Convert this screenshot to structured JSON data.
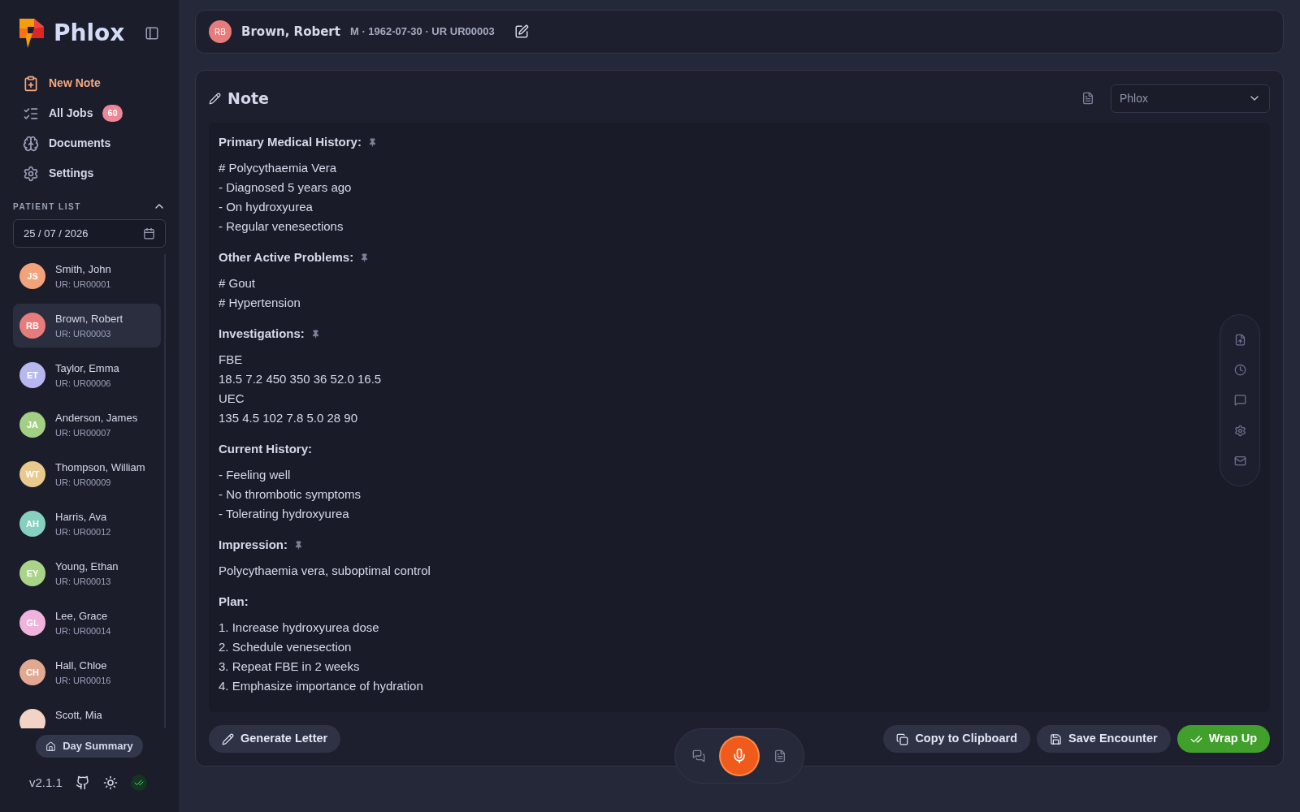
{
  "app": {
    "name": "Phlox",
    "version": "v2.1.1"
  },
  "nav": [
    {
      "kind": "new-note",
      "label": "New Note",
      "selected": true
    },
    {
      "kind": "jobs",
      "label": "All Jobs",
      "badge": "60",
      "selected": false
    },
    {
      "kind": "documents",
      "label": "Documents",
      "selected": false
    },
    {
      "kind": "settings",
      "label": "Settings",
      "selected": false
    }
  ],
  "patient_list": {
    "title": "PATIENT LIST",
    "expanded": true,
    "date": "25 / 07 / 2026",
    "patients": [
      {
        "initials": "JS",
        "name": "Smith, John",
        "ur": "UR: UR00001",
        "color": "#f4a27a",
        "selected": false
      },
      {
        "initials": "RB",
        "name": "Brown, Robert",
        "ur": "UR: UR00003",
        "color": "#e77c7c",
        "selected": true
      },
      {
        "initials": "ET",
        "name": "Taylor, Emma",
        "ur": "UR: UR00006",
        "color": "#b8b8f0",
        "selected": false
      },
      {
        "initials": "JA",
        "name": "Anderson, James",
        "ur": "UR: UR00007",
        "color": "#a3cf84",
        "selected": false
      },
      {
        "initials": "WT",
        "name": "Thompson, William",
        "ur": "UR: UR00009",
        "color": "#e8c98e",
        "selected": false
      },
      {
        "initials": "AH",
        "name": "Harris, Ava",
        "ur": "UR: UR00012",
        "color": "#86d0c0",
        "selected": false
      },
      {
        "initials": "EY",
        "name": "Young, Ethan",
        "ur": "UR: UR00013",
        "color": "#a8d488",
        "selected": false
      },
      {
        "initials": "GL",
        "name": "Lee, Grace",
        "ur": "UR: UR00014",
        "color": "#f0b4dc",
        "selected": false
      },
      {
        "initials": "CH",
        "name": "Hall, Chloe",
        "ur": "UR: UR00016",
        "color": "#e2a992",
        "selected": false
      },
      {
        "name": "Scott, Mia",
        "color": "#f3d3c6",
        "selected": false
      }
    ]
  },
  "day_summary": "Day Summary",
  "header": {
    "initials": "RB",
    "name": "Brown, Robert",
    "details": "M · 1962-07-30 · UR UR00003"
  },
  "note": {
    "title": "Note",
    "template": "Phlox",
    "sections": [
      {
        "heading": "Primary Medical History:",
        "pinned": true,
        "lines": [
          "# Polycythaemia Vera",
          "- Diagnosed 5 years ago",
          "- On hydroxyurea",
          "- Regular venesections"
        ]
      },
      {
        "heading": "Other Active Problems:",
        "pinned": true,
        "lines": [
          "# Gout",
          "# Hypertension"
        ]
      },
      {
        "heading": "Investigations:",
        "pinned": true,
        "lines": [
          "FBE",
          "18.5 7.2 450 350 36 52.0 16.5",
          "UEC",
          "135 4.5 102 7.8 5.0 28 90"
        ]
      },
      {
        "heading": "Current History:",
        "pinned": false,
        "lines": [
          "- Feeling well",
          "- No thrombotic symptoms",
          "- Tolerating hydroxyurea"
        ]
      },
      {
        "heading": "Impression:",
        "pinned": true,
        "lines": [
          "Polycythaemia vera, suboptimal control"
        ]
      },
      {
        "heading": "Plan:",
        "pinned": false,
        "lines": [
          "1. Increase hydroxyurea dose",
          "2. Schedule venesection",
          "3. Repeat FBE in 2 weeks",
          "4. Emphasize importance of hydration"
        ]
      }
    ]
  },
  "actions": [
    {
      "kind": "letter",
      "label": "Generate Letter"
    },
    {
      "kind": "copy",
      "label": "Copy to Clipboard"
    },
    {
      "kind": "save",
      "label": "Save Encounter"
    },
    {
      "kind": "wrap",
      "label": "Wrap Up"
    }
  ],
  "recording": {
    "active": true
  }
}
